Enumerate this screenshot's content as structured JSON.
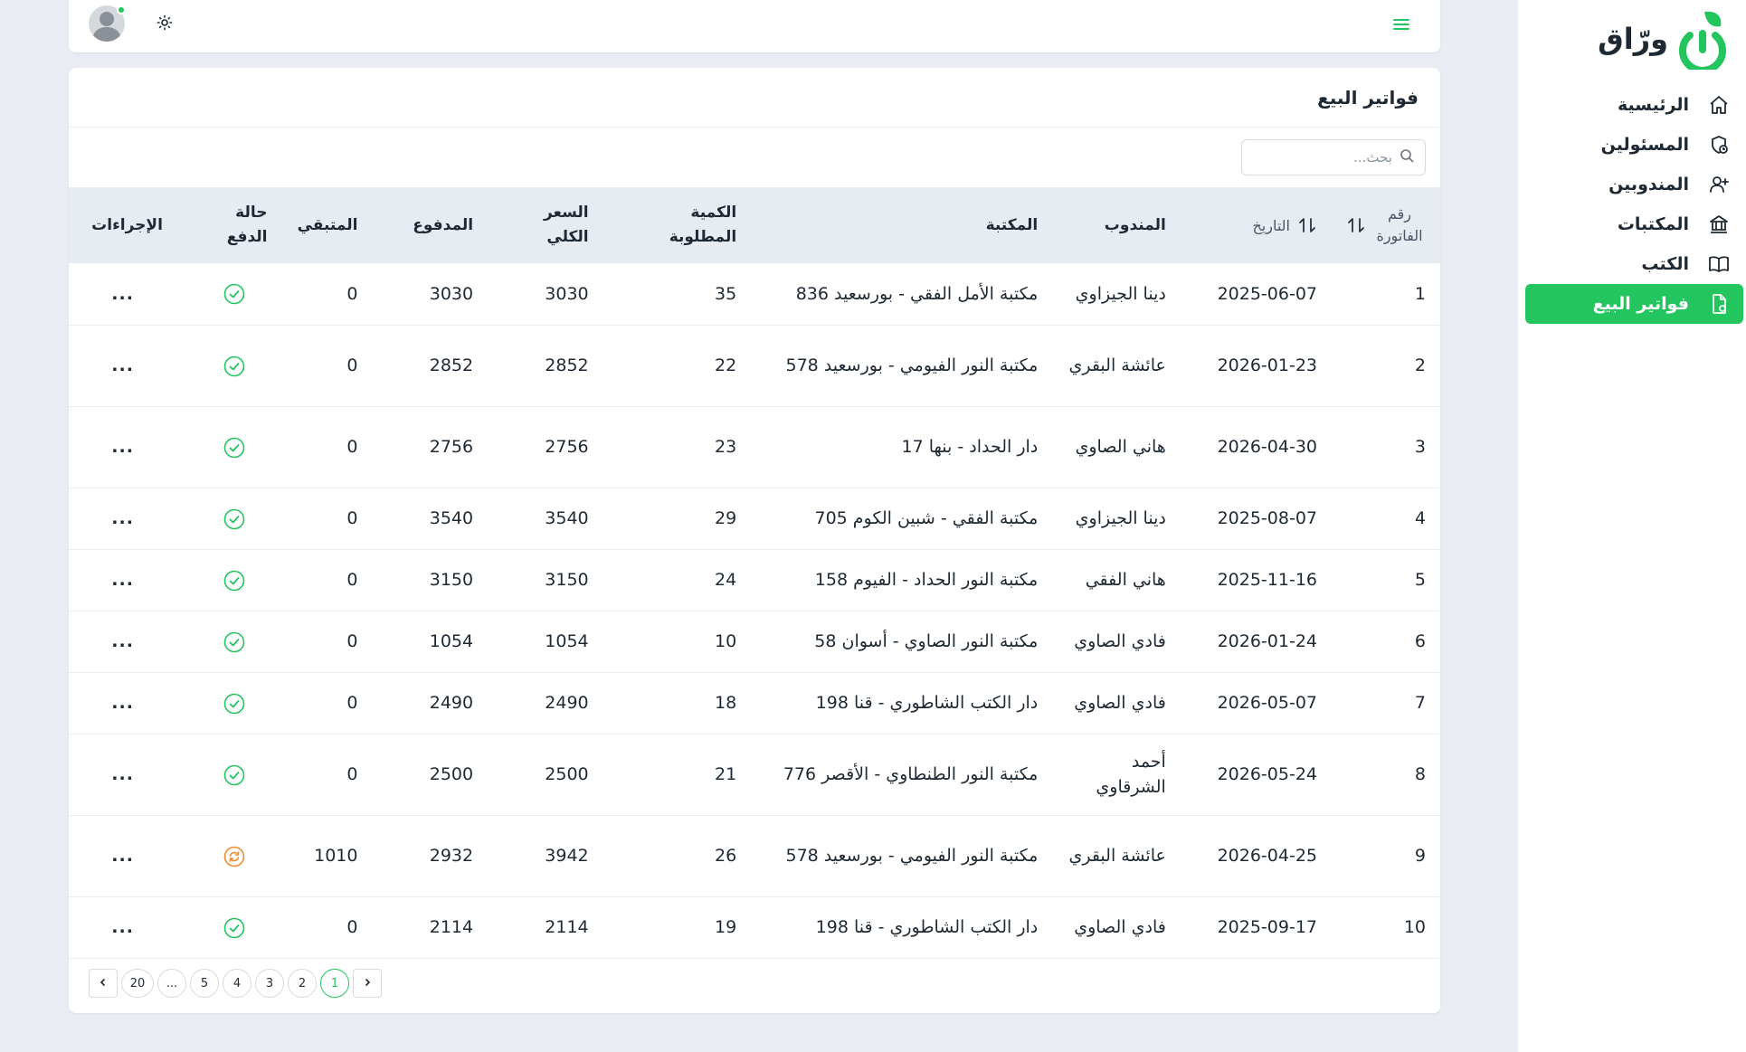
{
  "brand": {
    "name": "ورّاق",
    "color": "#22c55e"
  },
  "sidebar": {
    "items": [
      {
        "label": "الرئيسية",
        "icon": "home-icon",
        "active": false
      },
      {
        "label": "المسئولين",
        "icon": "admin-shield-icon",
        "active": false
      },
      {
        "label": "المندوبين",
        "icon": "user-plus-icon",
        "active": false
      },
      {
        "label": "المكتبات",
        "icon": "library-building-icon",
        "active": false
      },
      {
        "label": "الكتب",
        "icon": "book-open-icon",
        "active": false
      },
      {
        "label": "فواتير البيع",
        "icon": "invoice-file-icon",
        "active": true
      }
    ]
  },
  "page": {
    "title": "فواتير البيع",
    "search_placeholder": "بحث..."
  },
  "table": {
    "headers": {
      "invoice_no": "رقم الفاتورة",
      "date": "التاريخ",
      "agent": "المندوب",
      "library": "المكتبة",
      "qty": "الكمية المطلوبة",
      "total": "السعر الكلي",
      "paid": "المدفوع",
      "remaining": "المتبقي",
      "status": "حالة الدفع",
      "actions": "الإجراءات"
    },
    "rows": [
      {
        "no": "1",
        "date": "2025-06-07",
        "agent": "دينا الجيزاوي",
        "library": "مكتبة الأمل الفقي - بورسعيد 836",
        "qty": "35",
        "total": "3030",
        "paid": "3030",
        "remaining": "0",
        "status": "paid",
        "actions": "..."
      },
      {
        "no": "2",
        "date": "2026-01-23",
        "agent": "عائشة البقري",
        "library": "مكتبة النور الفيومي - بورسعيد 578",
        "qty": "22",
        "total": "2852",
        "paid": "2852",
        "remaining": "0",
        "status": "paid",
        "actions": "..."
      },
      {
        "no": "3",
        "date": "2026-04-30",
        "agent": "هاني الصاوي",
        "library": "دار الحداد - بنها 17",
        "qty": "23",
        "total": "2756",
        "paid": "2756",
        "remaining": "0",
        "status": "paid",
        "actions": "..."
      },
      {
        "no": "4",
        "date": "2025-08-07",
        "agent": "دينا الجيزاوي",
        "library": "مكتبة الفقي - شبين الكوم 705",
        "qty": "29",
        "total": "3540",
        "paid": "3540",
        "remaining": "0",
        "status": "paid",
        "actions": "..."
      },
      {
        "no": "5",
        "date": "2025-11-16",
        "agent": "هاني الفقي",
        "library": "مكتبة النور الحداد - الفيوم 158",
        "qty": "24",
        "total": "3150",
        "paid": "3150",
        "remaining": "0",
        "status": "paid",
        "actions": "..."
      },
      {
        "no": "6",
        "date": "2026-01-24",
        "agent": "فادي الصاوي",
        "library": "مكتبة النور الصاوي - أسوان 58",
        "qty": "10",
        "total": "1054",
        "paid": "1054",
        "remaining": "0",
        "status": "paid",
        "actions": "..."
      },
      {
        "no": "7",
        "date": "2026-05-07",
        "agent": "فادي الصاوي",
        "library": "دار الكتب الشاطوري - قنا 198",
        "qty": "18",
        "total": "2490",
        "paid": "2490",
        "remaining": "0",
        "status": "paid",
        "actions": "..."
      },
      {
        "no": "8",
        "date": "2026-05-24",
        "agent": "أحمد الشرقاوي",
        "library": "مكتبة النور الطنطاوي - الأقصر 776",
        "qty": "21",
        "total": "2500",
        "paid": "2500",
        "remaining": "0",
        "status": "paid",
        "actions": "..."
      },
      {
        "no": "9",
        "date": "2026-04-25",
        "agent": "عائشة البقري",
        "library": "مكتبة النور الفيومي - بورسعيد 578",
        "qty": "26",
        "total": "3942",
        "paid": "2932",
        "remaining": "1010",
        "status": "partial",
        "actions": "..."
      },
      {
        "no": "10",
        "date": "2025-09-17",
        "agent": "فادي الصاوي",
        "library": "دار الكتب الشاطوري - قنا 198",
        "qty": "19",
        "total": "2114",
        "paid": "2114",
        "remaining": "0",
        "status": "paid",
        "actions": "..."
      }
    ]
  },
  "status_colors": {
    "paid": "#22c55e",
    "partial": "#f08c2e"
  },
  "pagination": {
    "pages": [
      "1",
      "2",
      "3",
      "4",
      "5",
      "...",
      "20"
    ],
    "current": "1"
  }
}
